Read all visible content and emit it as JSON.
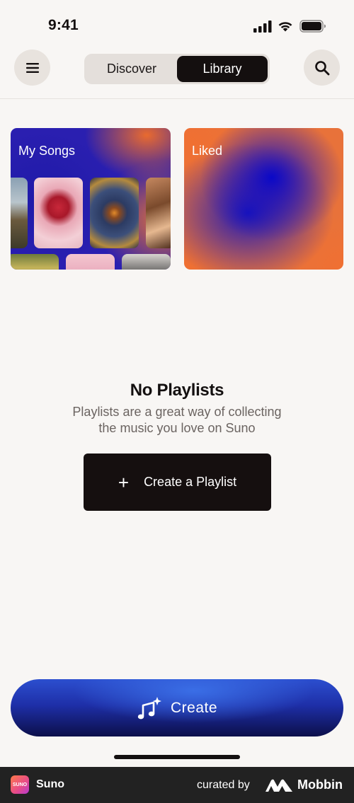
{
  "status_bar": {
    "time": "9:41"
  },
  "header": {
    "tabs": [
      {
        "label": "Discover",
        "active": false
      },
      {
        "label": "Library",
        "active": true
      }
    ]
  },
  "cards": [
    {
      "title": "My Songs"
    },
    {
      "title": "Liked"
    }
  ],
  "empty_state": {
    "title": "No Playlists",
    "description_line1": "Playlists are a great way of collecting",
    "description_line2": "the music you love on Suno",
    "button_label": "Create a Playlist"
  },
  "create_bar": {
    "label": "Create"
  },
  "footer": {
    "app_name": "Suno",
    "logo_text": "SUNO",
    "curated_by": "curated by",
    "brand": "Mobbin"
  },
  "colors": {
    "background": "#f8f6f4",
    "dark": "#150f0f",
    "orange": "#f0703a",
    "blue": "#1d17b8"
  }
}
